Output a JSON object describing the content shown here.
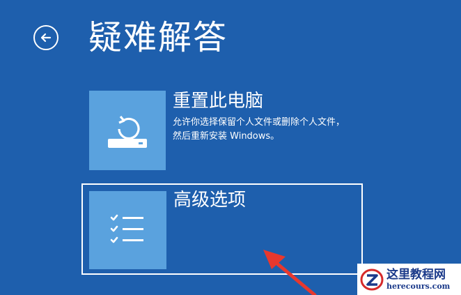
{
  "header": {
    "back_icon": "back-arrow-circle-icon",
    "title": "疑难解答"
  },
  "options": [
    {
      "icon": "reset-pc-icon",
      "title": "重置此电脑",
      "description": "允许你选择保留个人文件或删除个人文件，然后重新安装 Windows。"
    },
    {
      "icon": "checklist-icon",
      "title": "高级选项",
      "selected": true
    }
  ],
  "annotation": {
    "icon": "red-pointer-arrow",
    "color": "#e8382e"
  },
  "watermark": {
    "logo_icon": "z-logo-icon",
    "name": "这里教程网",
    "url": "herecours.com"
  },
  "colors": {
    "background": "#1e5fad",
    "tile": "#5aa2de",
    "text": "#ffffff"
  }
}
